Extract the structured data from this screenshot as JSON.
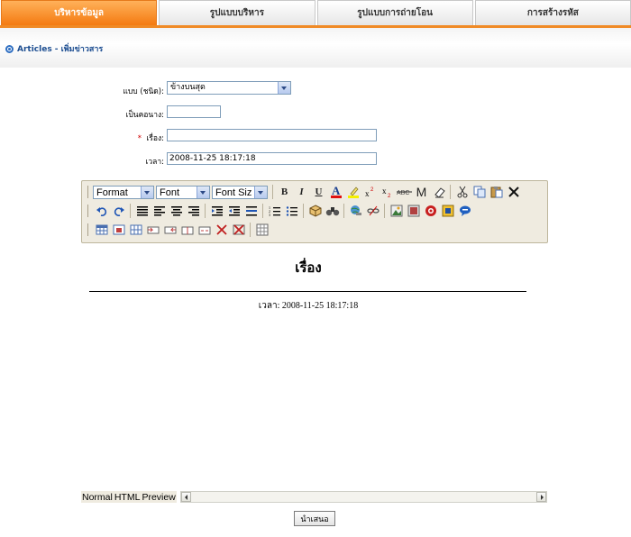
{
  "tabs": [
    {
      "label": "บริหารข้อมูล",
      "active": true
    },
    {
      "label": "รูปแบบบริหาร",
      "active": false
    },
    {
      "label": "รูปแบบการถ่ายโอน",
      "active": false
    },
    {
      "label": "การสร้างรหัส",
      "active": false
    }
  ],
  "breadcrumb": {
    "text": "Articles - เพิ่มข่าวสาร"
  },
  "form": {
    "type_label": "แบบ (ชนิด):",
    "type_value": "ข้างบนสุด",
    "order_label": "เป็นคอนาง:",
    "order_value": "",
    "required_mark": "*",
    "subject_label": "เรื่อง:",
    "subject_value": "",
    "time_label": "เวลา:",
    "time_value": "2008-11-25 18:17:18"
  },
  "toolbar": {
    "format_select": "Format",
    "font_select": "Font",
    "fontsize_select": "Font Siz",
    "bold": "B",
    "italic": "I",
    "underline": "U",
    "strike_label": "ABC",
    "mark_m": "M"
  },
  "editor": {
    "title": "เรื่อง",
    "time_line": "เวลา: 2008-11-25 18:17:18"
  },
  "modes": {
    "normal": "Normal",
    "html": "HTML",
    "preview": "Preview"
  },
  "submit": {
    "label": "นำเสนอ"
  },
  "colors": {
    "tab_active": "#f47a10",
    "link": "#1d4e91",
    "toolbar_bg": "#efebe0"
  }
}
